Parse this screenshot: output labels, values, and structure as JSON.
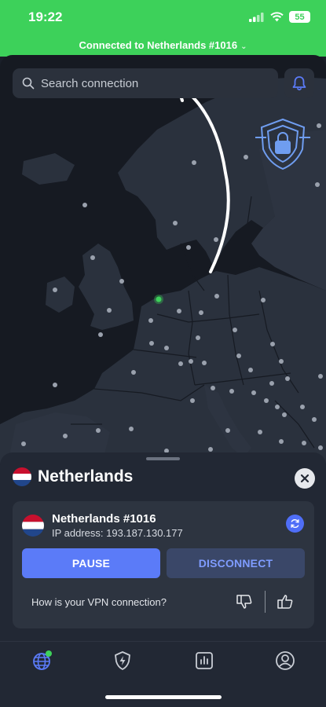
{
  "status_bar": {
    "time": "19:22",
    "battery": "55"
  },
  "connection_banner": {
    "text": "Connected to Netherlands #1016"
  },
  "search": {
    "placeholder": "Search connection"
  },
  "sheet": {
    "country": "Netherlands",
    "server_name": "Netherlands #1016",
    "ip_address": "IP address: 193.187.130.177",
    "pause_label": "PAUSE",
    "disconnect_label": "DISCONNECT",
    "feedback_question": "How is your VPN connection?"
  },
  "tabs": [
    {
      "icon": "globe-icon",
      "active": true
    },
    {
      "icon": "shield-bolt-icon",
      "active": false
    },
    {
      "icon": "chart-icon",
      "active": false
    },
    {
      "icon": "profile-icon",
      "active": false
    }
  ],
  "colors": {
    "accent": "#5b7bf8",
    "connected_green": "#3dd15a",
    "map_land": "#2a313d",
    "map_sea": "#161a22"
  }
}
